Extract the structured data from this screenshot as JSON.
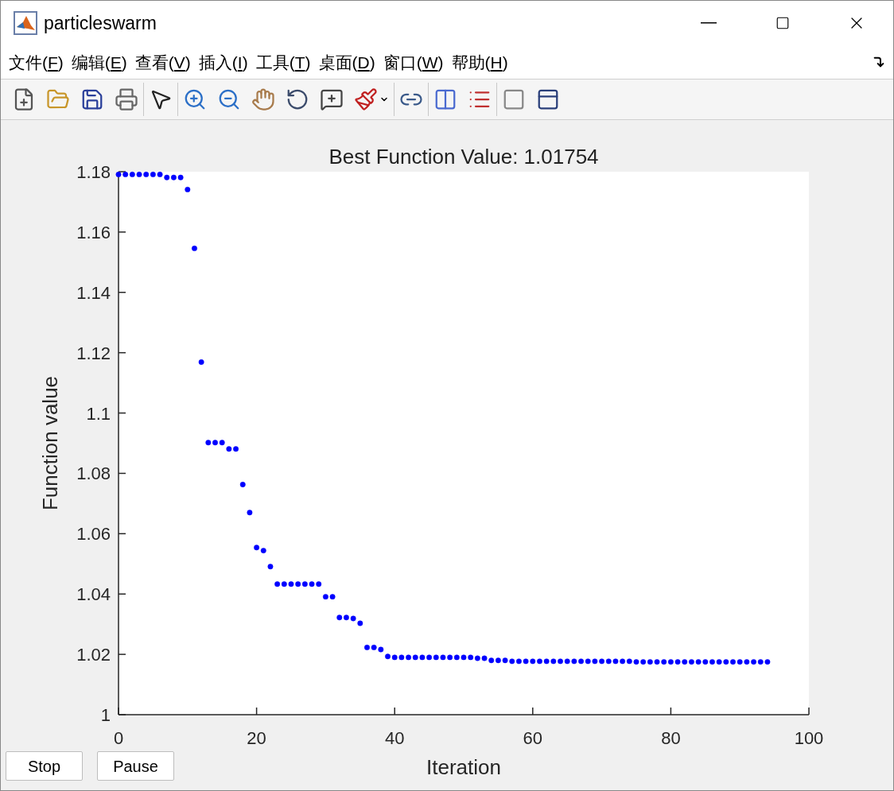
{
  "window": {
    "title": "particleswarm"
  },
  "menu": [
    "文件(F)",
    "编辑(E)",
    "查看(V)",
    "插入(I)",
    "工具(T)",
    "桌面(D)",
    "窗口(W)",
    "帮助(H)"
  ],
  "figure": {
    "chart_data": {
      "type": "scatter",
      "title": "Best Function Value: 1.01754",
      "xlabel": "Iteration",
      "ylabel": "Function value",
      "xlim": [
        0,
        100
      ],
      "ylim": [
        1,
        1.18
      ],
      "xticks": [
        0,
        20,
        40,
        60,
        80,
        100
      ],
      "yticks": [
        1,
        1.02,
        1.04,
        1.06,
        1.08,
        1.1,
        1.12,
        1.14,
        1.16,
        1.18
      ],
      "x": [
        0,
        1,
        2,
        3,
        4,
        5,
        6,
        7,
        8,
        9,
        10,
        11,
        12,
        13,
        14,
        15,
        16,
        17,
        18,
        19,
        20,
        21,
        22,
        23,
        24,
        25,
        26,
        27,
        28,
        29,
        30,
        31,
        32,
        33,
        34,
        35,
        36,
        37,
        38,
        39,
        40,
        41,
        42,
        43,
        44,
        45,
        46,
        47,
        48,
        49,
        50,
        51,
        52,
        53,
        54,
        55,
        56,
        57,
        58,
        59,
        60,
        61,
        62,
        63,
        64,
        65,
        66,
        67,
        68,
        69,
        70,
        71,
        72,
        73,
        74,
        75,
        76,
        77,
        78,
        79,
        80,
        81,
        82,
        83,
        84,
        85,
        86,
        87,
        88,
        89,
        90,
        91,
        92,
        93,
        94
      ],
      "series": [
        {
          "color": "#0000ff",
          "values": [
            1.1791,
            1.1791,
            1.1791,
            1.1791,
            1.1791,
            1.1791,
            1.1791,
            1.1781,
            1.1781,
            1.1781,
            1.1741,
            1.1546,
            1.1169,
            1.0902,
            1.0902,
            1.0902,
            1.0881,
            1.0881,
            1.0763,
            1.067,
            1.0554,
            1.0544,
            1.0491,
            1.0433,
            1.0433,
            1.0433,
            1.0433,
            1.0433,
            1.0433,
            1.0433,
            1.0391,
            1.0391,
            1.0322,
            1.0322,
            1.0319,
            1.0303,
            1.0223,
            1.0223,
            1.0216,
            1.0193,
            1.019,
            1.019,
            1.019,
            1.019,
            1.019,
            1.019,
            1.019,
            1.019,
            1.019,
            1.019,
            1.019,
            1.019,
            1.0187,
            1.0187,
            1.018,
            1.018,
            1.018,
            1.0177,
            1.0177,
            1.0177,
            1.0177,
            1.0177,
            1.0177,
            1.0177,
            1.0177,
            1.0177,
            1.0177,
            1.0177,
            1.0177,
            1.0177,
            1.0177,
            1.0177,
            1.0177,
            1.0177,
            1.0177,
            1.0175,
            1.0175,
            1.0175,
            1.0175,
            1.0175,
            1.0175,
            1.0175,
            1.0175,
            1.0175,
            1.0175,
            1.0175,
            1.0175,
            1.0175,
            1.0175,
            1.0175,
            1.0175,
            1.0175,
            1.0175,
            1.0175,
            1.0175
          ]
        }
      ]
    },
    "buttons": [
      "Stop",
      "Pause"
    ]
  }
}
